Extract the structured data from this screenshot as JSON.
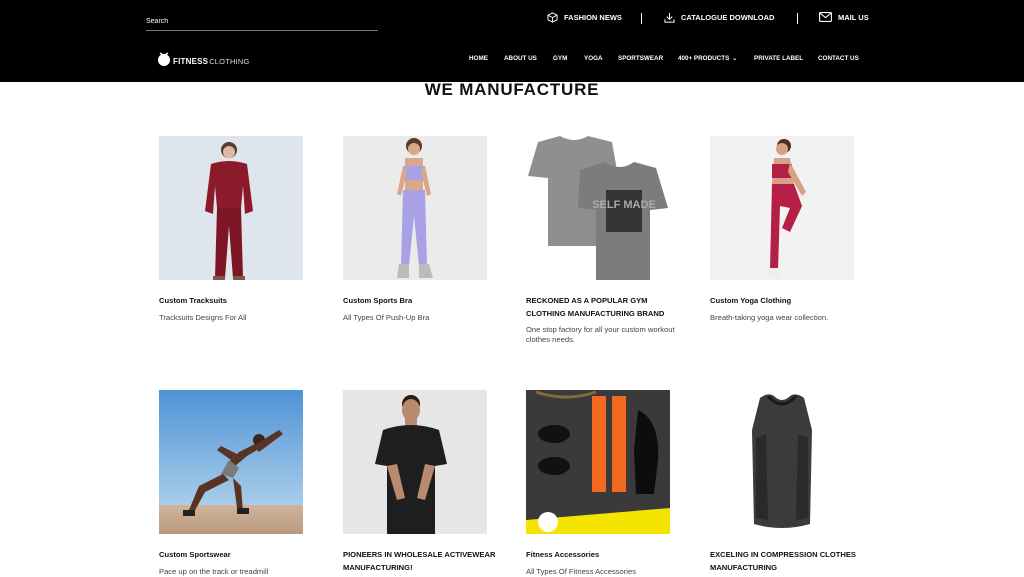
{
  "header": {
    "search": {
      "placeholder": "Search",
      "value": ""
    },
    "top_links": [
      {
        "label": "FASHION NEWS",
        "icon": "cube-icon"
      },
      {
        "label": "CATALOGUE DOWNLOAD",
        "icon": "download-icon"
      },
      {
        "label": "MAIL US",
        "icon": "mail-icon"
      }
    ],
    "logo": {
      "word1": "FITNESS",
      "word2": "CLOTHING"
    },
    "nav": [
      "HOME",
      "ABOUT US",
      "GYM",
      "YOGA",
      "SPORTSWEAR",
      "400+ PRODUCTS",
      "PRIVATE LABEL",
      "CONTACT US"
    ]
  },
  "section": {
    "title": "WE MANUFACTURE",
    "cards": [
      {
        "title": "Custom Tracksuits",
        "desc": "Tracksuits Designs For All"
      },
      {
        "title": "Custom Sports Bra",
        "desc": "All Types Of Push-Up Bra"
      },
      {
        "title": "RECKONED AS A POPULAR GYM CLOTHING MANUFACTURING BRAND",
        "desc": "One stop factory for all your custom workout clothes needs.",
        "print_text": "SELF MADE"
      },
      {
        "title": "Custom Yoga Clothing",
        "desc": "Breath-taking yoga wear collection."
      },
      {
        "title": "Custom Sportswear",
        "desc": "Pace up on the track or treadmill"
      },
      {
        "title": "PIONEERS IN WHOLESALE ACTIVEWEAR MANUFACTURING!",
        "desc": ""
      },
      {
        "title": "Fitness Accessories",
        "desc": "All Types Of Fitness Accessories"
      },
      {
        "title": "EXCELING IN COMPRESSION CLOTHES MANUFACTURING",
        "desc": ""
      }
    ]
  },
  "colors": {
    "header_bg": "#000000",
    "accent_orange": "#f26a21",
    "accent_yellow": "#f5e400",
    "maroon": "#8b1a2b",
    "lavender": "#a9a1e6"
  }
}
